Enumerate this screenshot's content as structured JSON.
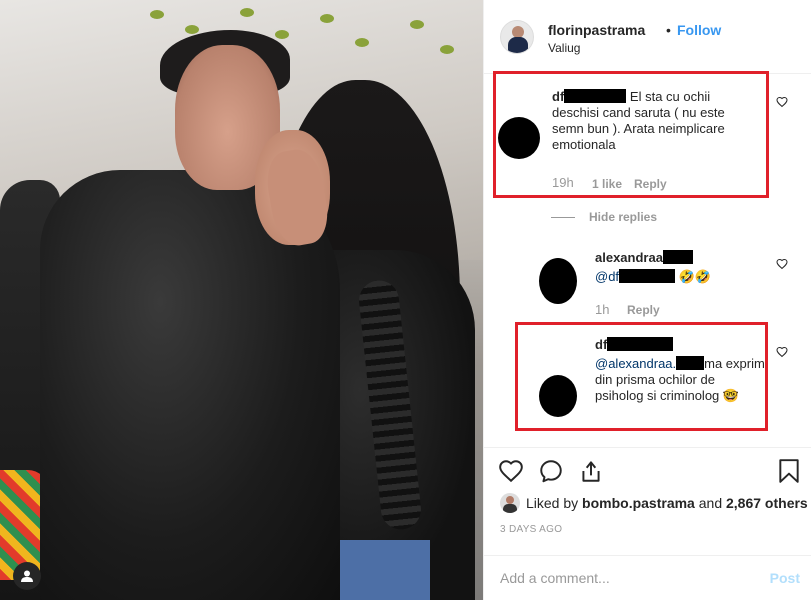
{
  "post": {
    "username": "florinpastrama",
    "separator": "•",
    "follow_label": "Follow",
    "location": "Valiug"
  },
  "comments": [
    {
      "username_prefix": "df",
      "text": "El sta cu ochii deschisi cand saruta ( nu este semn bun ). Arata neimplicare emotionala",
      "time": "19h",
      "likes": "1 like",
      "reply_label": "Reply"
    }
  ],
  "hide_replies_label": "Hide replies",
  "replies": [
    {
      "username_prefix": "alexandraa",
      "mention_prefix": "@df",
      "emoji": "🤣🤣",
      "time": "1h",
      "reply_label": "Reply"
    },
    {
      "username_prefix": "df",
      "mention_prefix": "@alexandraa.",
      "text": "ma exprim din prisma ochilor de psiholog si criminolog",
      "emoji": "🤓"
    }
  ],
  "actions": {
    "liked_prefix": "Liked by",
    "liked_user": "bombo.pastrama",
    "liked_and": "and",
    "liked_count": "2,867 others",
    "date": "3 DAYS AGO",
    "add_comment_placeholder": "Add a comment...",
    "post_label": "Post"
  },
  "colors": {
    "follow": "#3897f0",
    "highlight": "#e0202a",
    "meta": "#999999"
  },
  "icons": [
    "heart-icon",
    "comment-icon",
    "share-icon",
    "bookmark-icon",
    "user-tag-icon"
  ]
}
